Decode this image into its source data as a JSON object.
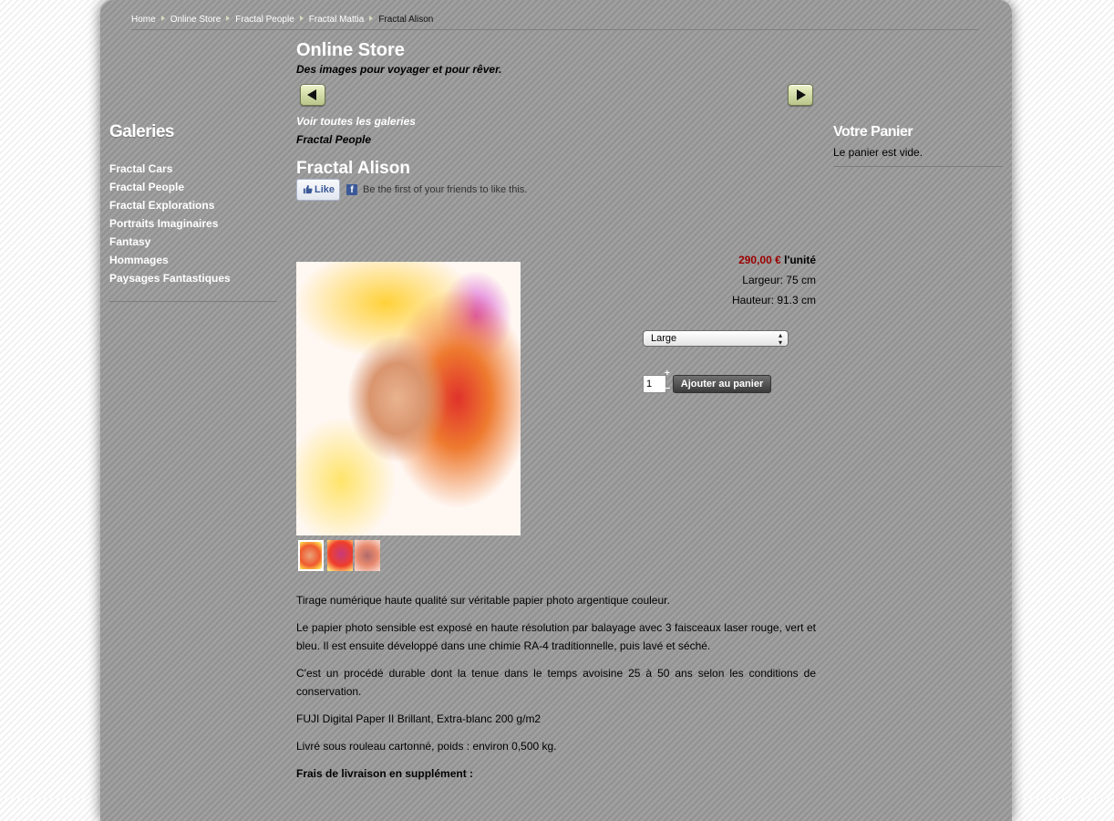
{
  "breadcrumb": {
    "items": [
      "Home",
      "Online Store",
      "Fractal People",
      "Fractal Mattia",
      "Fractal Alison"
    ]
  },
  "sidebar": {
    "title": "Galeries",
    "items": [
      "Fractal Cars",
      "Fractal People",
      "Fractal Explorations",
      "Portraits Imaginaires",
      "Fantasy",
      "Hommages",
      "Paysages Fantastiques"
    ]
  },
  "store": {
    "title": "Online Store",
    "subtitle": "Des images pour voyager et pour rêver.",
    "all_galleries_link": "Voir toutes les galeries",
    "current_gallery_link": "Fractal People",
    "prev_icon": "arrow-left-icon",
    "next_icon": "arrow-right-icon"
  },
  "product": {
    "title": "Fractal Alison",
    "price": "290,00 €",
    "price_unit": "l'unité",
    "width": "Largeur: 75 cm",
    "height": "Hauteur: 91.3 cm",
    "size_selected": "Large",
    "quantity": "1",
    "qty_plus": "+",
    "add_to_cart": "Ajouter au panier"
  },
  "facebook": {
    "like_label": "Like",
    "logo": "f",
    "text": "Be the first of your friends to like this.",
    "color": "#3b5998"
  },
  "description": {
    "p1": "Tirage numérique haute qualité sur véritable papier photo argentique couleur.",
    "p2": "Le papier photo sensible est exposé en haute résolution par balayage avec 3 faisceaux laser rouge, vert et bleu. Il est ensuite développé dans une chimie RA-4 traditionnelle, puis lavé et séché.",
    "p3": "C'est un procédé durable dont la tenue dans le temps avoisine 25 à 50 ans selon les conditions de conservation.",
    "p4": "FUJI Digital Paper II Brillant, Extra-blanc 200 g/m2",
    "p5": "Livré sous rouleau cartonné, poids : environ 0,500 kg.",
    "p6": "Frais de livraison en supplément :"
  },
  "cart": {
    "title": "Votre Panier",
    "empty_text": "Le panier est vide."
  },
  "colors": {
    "price": "#9b0000",
    "page_bg": "#9a9a9a"
  }
}
